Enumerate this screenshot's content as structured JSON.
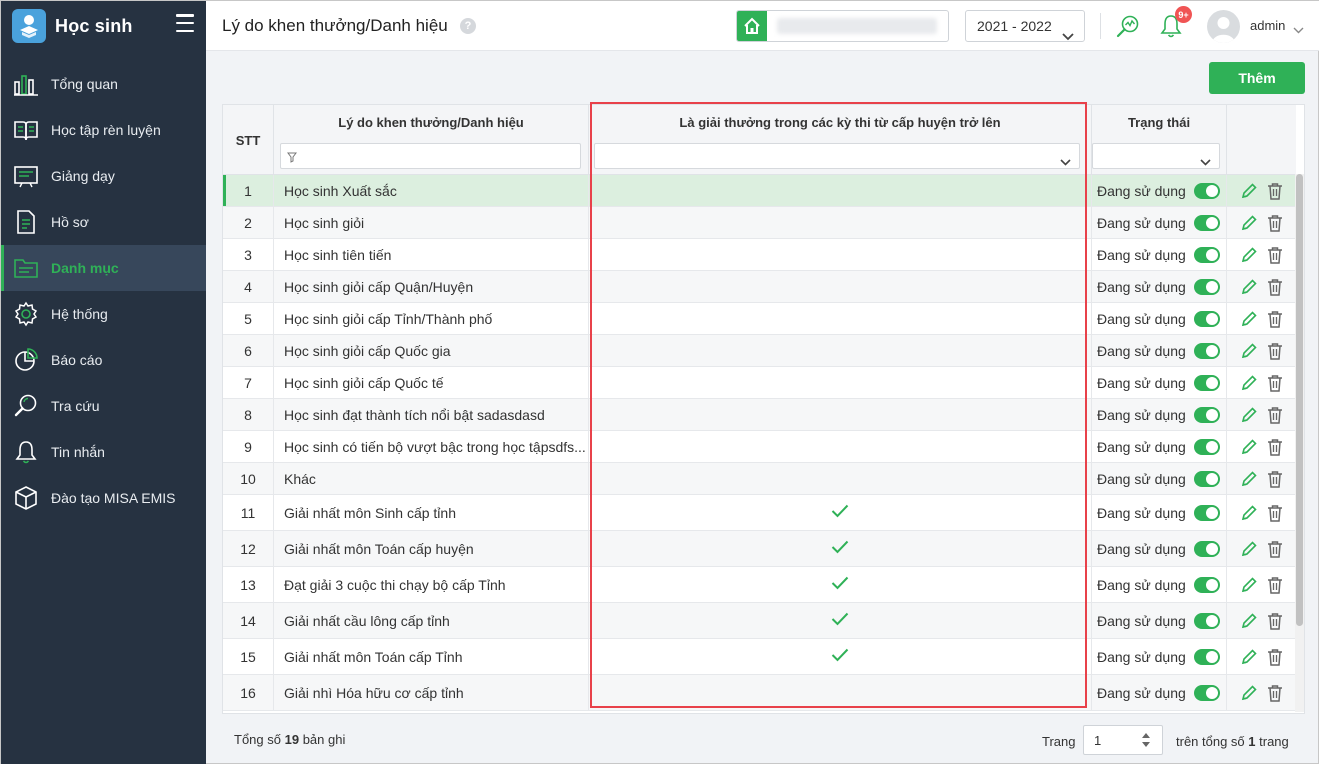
{
  "app": {
    "title": "Học sinh"
  },
  "sidebar": {
    "items": [
      {
        "label": "Tổng quan",
        "icon": "chart-bars-icon"
      },
      {
        "label": "Học tập rèn luyện",
        "icon": "book-icon"
      },
      {
        "label": "Giảng dạy",
        "icon": "board-icon"
      },
      {
        "label": "Hồ sơ",
        "icon": "document-icon"
      },
      {
        "label": "Danh mục",
        "icon": "folder-icon",
        "active": true
      },
      {
        "label": "Hệ thống",
        "icon": "gear-icon"
      },
      {
        "label": "Báo cáo",
        "icon": "pie-chart-icon"
      },
      {
        "label": "Tra cứu",
        "icon": "search-icon"
      },
      {
        "label": "Tin nhắn",
        "icon": "bell-icon"
      },
      {
        "label": "Đào tạo MISA EMIS",
        "icon": "cube-icon"
      }
    ]
  },
  "header": {
    "title": "Lý do khen thưởng/Danh hiệu",
    "help": "?",
    "year": "2021 - 2022",
    "notif_badge": "9+",
    "user": "admin"
  },
  "toolbar": {
    "add_label": "Thêm"
  },
  "table": {
    "columns": {
      "stt": "STT",
      "name": "Lý do khen thưởng/Danh hiệu",
      "award": "Là giải thưởng trong các kỳ thi từ cấp huyện trở lên",
      "status": "Trạng thái"
    },
    "rows": [
      {
        "stt": "1",
        "name": "Học sinh Xuất sắc",
        "award": false,
        "status": "Đang sử dụng"
      },
      {
        "stt": "2",
        "name": "Học sinh giỏi",
        "award": false,
        "status": "Đang sử dụng"
      },
      {
        "stt": "3",
        "name": "Học sinh tiên tiến",
        "award": false,
        "status": "Đang sử dụng"
      },
      {
        "stt": "4",
        "name": "Học sinh giỏi cấp Quận/Huyện",
        "award": false,
        "status": "Đang sử dụng"
      },
      {
        "stt": "5",
        "name": "Học sinh giỏi cấp Tỉnh/Thành phố",
        "award": false,
        "status": "Đang sử dụng"
      },
      {
        "stt": "6",
        "name": "Học sinh giỏi cấp Quốc gia",
        "award": false,
        "status": "Đang sử dụng"
      },
      {
        "stt": "7",
        "name": "Học sinh giỏi cấp Quốc tế",
        "award": false,
        "status": "Đang sử dụng"
      },
      {
        "stt": "8",
        "name": "Học sinh đạt thành tích nổi bật sadasdasd",
        "award": false,
        "status": "Đang sử dụng"
      },
      {
        "stt": "9",
        "name": "Học sinh có tiến bộ vượt bậc trong học tậpsdfs...",
        "award": false,
        "status": "Đang sử dụng"
      },
      {
        "stt": "10",
        "name": "Khác",
        "award": false,
        "status": "Đang sử dụng"
      },
      {
        "stt": "11",
        "name": "Giải nhất môn Sinh cấp tỉnh",
        "award": true,
        "status": "Đang sử dụng"
      },
      {
        "stt": "12",
        "name": "Giải nhất môn Toán cấp huyện",
        "award": true,
        "status": "Đang sử dụng"
      },
      {
        "stt": "13",
        "name": "Đạt giải 3 cuộc thi chạy bộ cấp Tỉnh",
        "award": true,
        "status": "Đang sử dụng"
      },
      {
        "stt": "14",
        "name": "Giải nhất cầu lông cấp tỉnh",
        "award": true,
        "status": "Đang sử dụng"
      },
      {
        "stt": "15",
        "name": "Giải nhất môn Toán cấp Tỉnh",
        "award": true,
        "status": "Đang sử dụng"
      },
      {
        "stt": "16",
        "name": "Giải nhì Hóa hữu cơ cấp tỉnh",
        "award": false,
        "status": "Đang sử dụng"
      }
    ]
  },
  "footer": {
    "total_prefix": "Tổng số",
    "total_count": "19",
    "total_suffix": "bản ghi",
    "page_label": "Trang",
    "page_value": "1",
    "of_prefix": "trên tổng số",
    "page_total": "1",
    "of_suffix": "trang"
  },
  "colors": {
    "accent": "#2fb157",
    "sidebar_bg": "#263241",
    "highlight": "#e8414a",
    "badge": "#f05454"
  }
}
